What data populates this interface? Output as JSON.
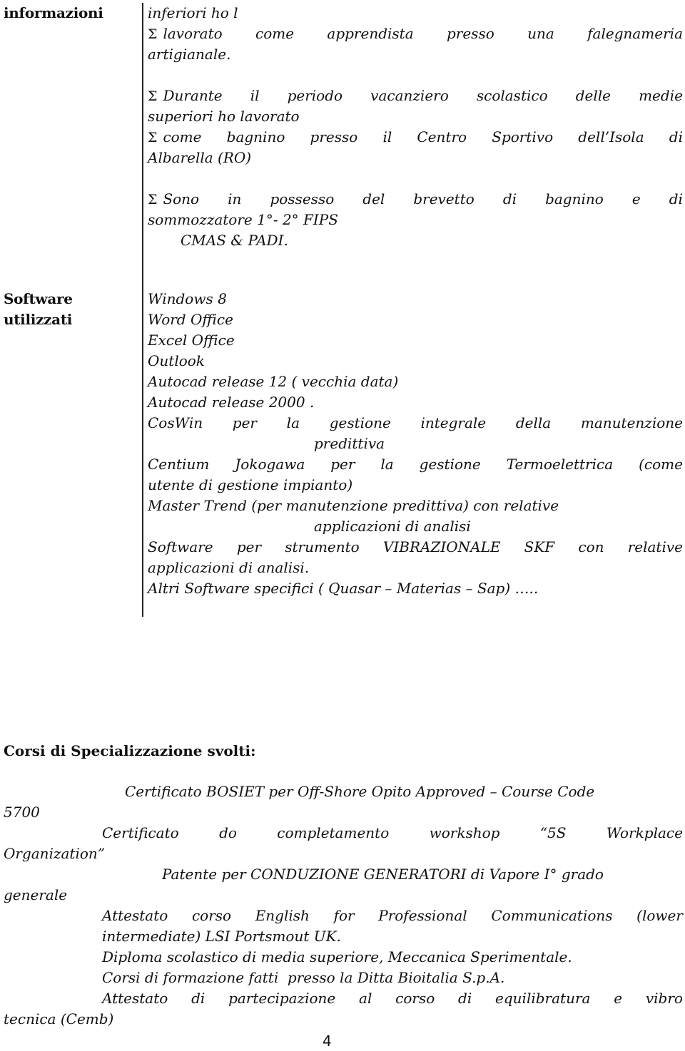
{
  "section_informazioni": {
    "label": "informazioni",
    "bullet_symbol": "Σ",
    "lines": {
      "l0": "inferiori ho l",
      "l1_words": [
        "lavorato",
        "come",
        "apprendista",
        "presso",
        "una",
        "falegnameria"
      ],
      "l2": "artigianale.",
      "l3_words": [
        "Durante",
        "il",
        "periodo",
        "vacanziero",
        "scolastico",
        "delle",
        "medie"
      ],
      "l4": "superiori ho lavorato",
      "l5_words": [
        "come",
        "bagnino",
        "presso",
        "il",
        "Centro",
        "Sportivo",
        "dell’Isola",
        "di"
      ],
      "l6": "Albarella (RO)",
      "l7_words": [
        "Sono",
        "in",
        "possesso",
        "del",
        "brevetto",
        "di",
        "bagnino",
        "e",
        "di"
      ],
      "l8": "sommozzatore 1°- 2° FIPS",
      "l9": "CMAS & PADI."
    }
  },
  "section_software": {
    "label_line1": "Software",
    "label_line2": "utilizzati",
    "items": {
      "s0": "Windows 8",
      "s1": "Word Office",
      "s2": "Excel Office",
      "s3": "Outlook",
      "s4": "Autocad release 12 ( vecchia data)",
      "s5": "Autocad release 2000 .",
      "s6_words": [
        "CosWin",
        "per",
        "la",
        "gestione",
        "integrale",
        "della",
        "manutenzione"
      ],
      "s6b": "predittiva",
      "s7_words": [
        "Centium",
        "Jokogawa",
        "per",
        "la",
        "gestione",
        "Termoelettrica",
        "(come"
      ],
      "s7b": "utente di gestione impianto)",
      "s8": "Master Trend (per manutenzione predittiva) con relative",
      "s8b": "applicazioni di analisi",
      "s9_words": [
        "Software",
        "per",
        "strumento",
        "VIBRAZIONALE",
        "SKF",
        "con",
        "relative"
      ],
      "s9b": "applicazioni di analisi.",
      "s10": "Altri Software specifici ( Quasar – Materias – Sap) ….."
    }
  },
  "section_corsi": {
    "heading": "Corsi di Specializzazione svolti:",
    "c0a": "Certificato BOSIET per Off-Shore Opito Approved – Course Code",
    "c0b": "5700",
    "c1_words": [
      "Certificato",
      "do",
      "completamento",
      "workshop",
      "“5S",
      "Workplace"
    ],
    "c1b": "Organization”",
    "c2a": "Patente per CONDUZIONE GENERATORI di Vapore I° grado",
    "c2b": "generale",
    "c3_words": [
      "Attestato",
      "corso",
      "English",
      "for",
      "Professional",
      "Communications",
      "(lower"
    ],
    "c3b": "intermediate) LSI Portsmout UK.",
    "c4": "Diploma scolastico di media superiore, Meccanica Sperimentale.",
    "c5": "Corsi di formazione fatti  presso la Ditta Bioitalia S.p.A.",
    "c6_words": [
      "Attestato",
      "di",
      "partecipazione",
      "al",
      "corso",
      "di",
      "equilibratura",
      "e",
      "vibro"
    ],
    "c6b": "tecnica (Cemb)"
  },
  "page_number": "4"
}
